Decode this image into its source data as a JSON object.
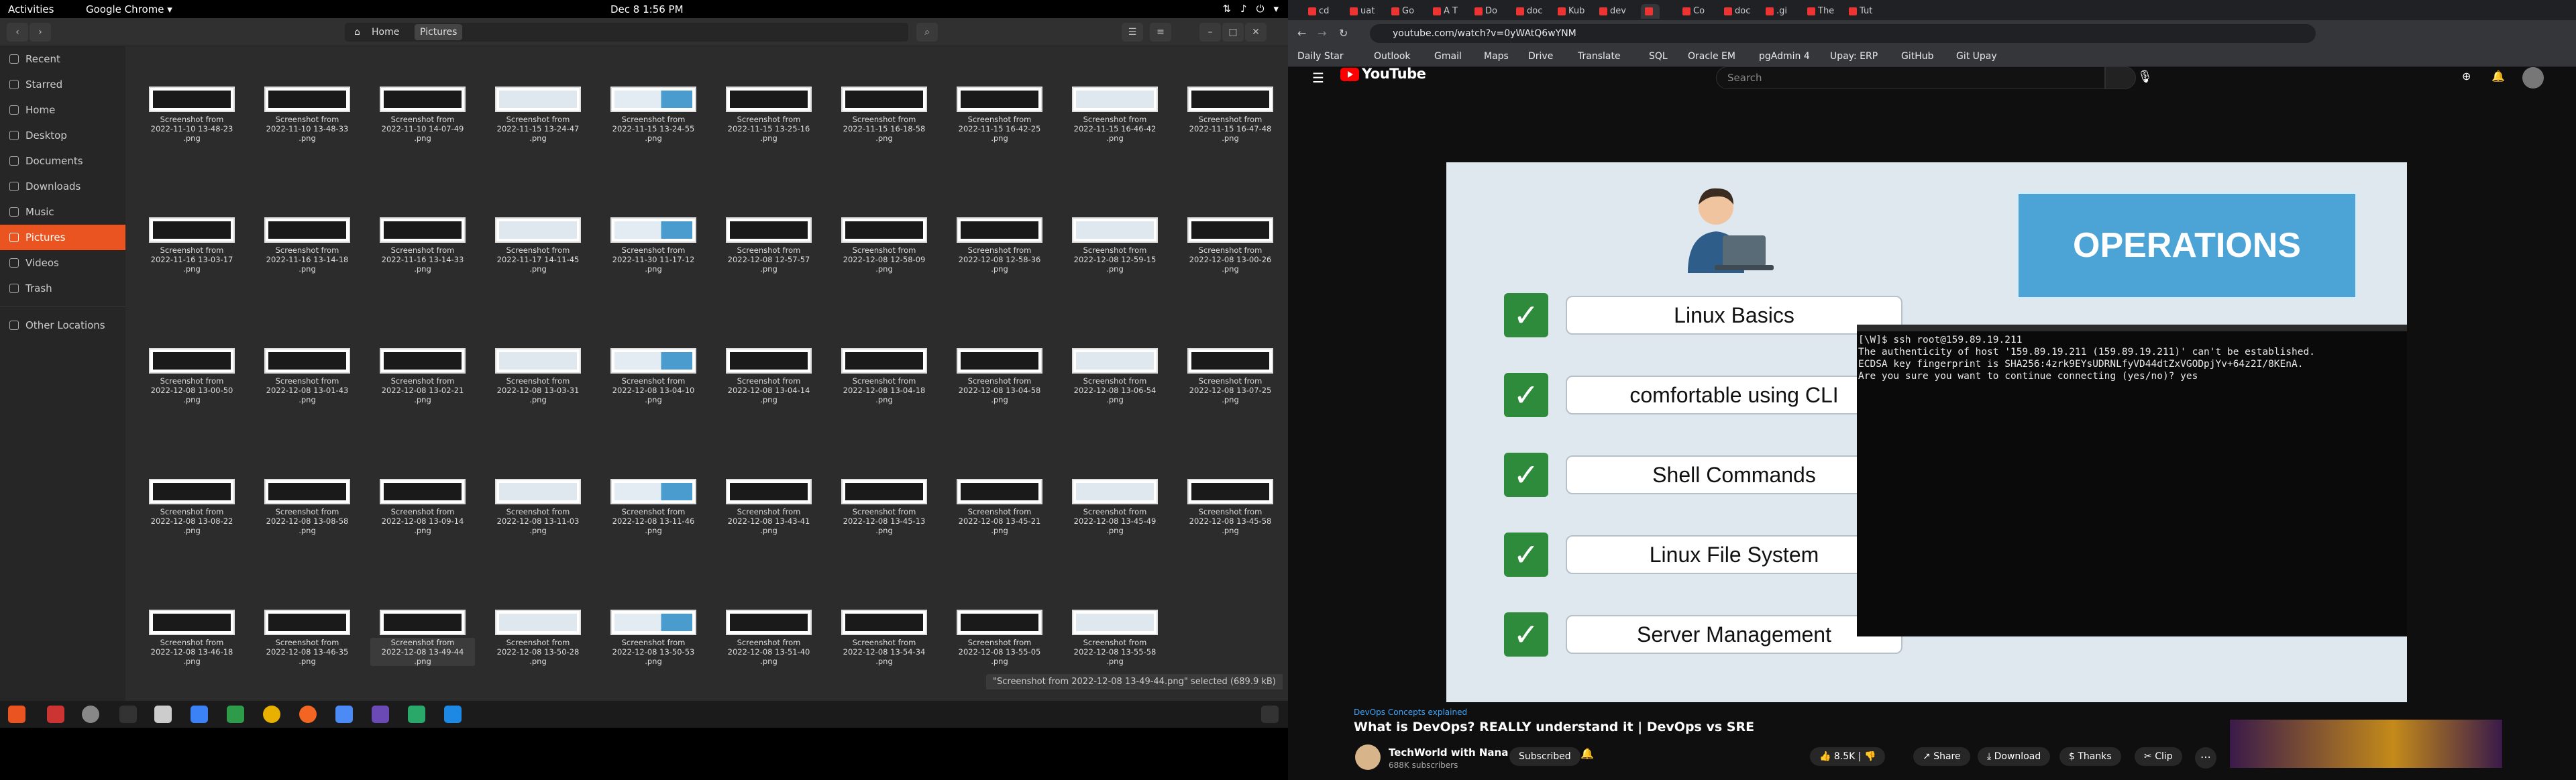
{
  "topbar": {
    "activities": "Activities",
    "app": "Google Chrome ▾",
    "clock": "Dec 8  1:56 PM"
  },
  "files": {
    "nav": {
      "home": "Home",
      "pictures": "Pictures"
    },
    "sidebar": [
      {
        "label": "Recent",
        "icon": "clock-icon"
      },
      {
        "label": "Starred",
        "icon": "star-icon"
      },
      {
        "label": "Home",
        "icon": "home-icon"
      },
      {
        "label": "Desktop",
        "icon": "desktop-icon"
      },
      {
        "label": "Documents",
        "icon": "document-icon"
      },
      {
        "label": "Downloads",
        "icon": "download-icon"
      },
      {
        "label": "Music",
        "icon": "music-icon"
      },
      {
        "label": "Pictures",
        "icon": "image-icon",
        "selected": true
      },
      {
        "label": "Videos",
        "icon": "video-icon"
      },
      {
        "label": "Trash",
        "icon": "trash-icon"
      },
      {
        "label": "Other Locations",
        "icon": "plus-icon"
      }
    ],
    "files": [
      "2022-11-10 13-48-23",
      "2022-11-10 13-48-33",
      "2022-11-10 14-07-49",
      "2022-11-15 13-24-47",
      "2022-11-15 13-24-55",
      "2022-11-15 13-25-16",
      "2022-11-15 16-18-58",
      "2022-11-15 16-42-25",
      "2022-11-15 16-46-42",
      "2022-11-15 16-47-48",
      "2022-11-16 13-03-17",
      "2022-11-16 13-14-18",
      "2022-11-16 13-14-33",
      "2022-11-17 14-11-45",
      "2022-11-30 11-17-12",
      "2022-12-08 12-57-57",
      "2022-12-08 12-58-09",
      "2022-12-08 12-58-36",
      "2022-12-08 12-59-15",
      "2022-12-08 13-00-26",
      "2022-12-08 13-00-50",
      "2022-12-08 13-01-43",
      "2022-12-08 13-02-21",
      "2022-12-08 13-03-31",
      "2022-12-08 13-04-10",
      "2022-12-08 13-04-14",
      "2022-12-08 13-04-18",
      "2022-12-08 13-04-58",
      "2022-12-08 13-06-54",
      "2022-12-08 13-07-25",
      "2022-12-08 13-08-22",
      "2022-12-08 13-08-58",
      "2022-12-08 13-09-14",
      "2022-12-08 13-11-03",
      "2022-12-08 13-11-46",
      "2022-12-08 13-43-41",
      "2022-12-08 13-45-13",
      "2022-12-08 13-45-21",
      "2022-12-08 13-45-49",
      "2022-12-08 13-45-58",
      "2022-12-08 13-46-18",
      "2022-12-08 13-46-35",
      "2022-12-08 13-49-44",
      "2022-12-08 13-50-28",
      "2022-12-08 13-50-53",
      "2022-12-08 13-51-40",
      "2022-12-08 13-54-34",
      "2022-12-08 13-55-05",
      "2022-12-08 13-55-58"
    ],
    "file_prefix": "Screenshot from",
    "file_suffix": ".png",
    "selected_index": 42,
    "status": "\"Screenshot from 2022-12-08 13-49-44.png\" selected (689.9 kB)"
  },
  "chrome": {
    "tabs": [
      "cd",
      "uat",
      "Go",
      "A T",
      "Do",
      "doc",
      "Kub",
      "dev",
      "",
      "Co",
      "doc",
      ".gi",
      "The",
      "Tut"
    ],
    "url": "youtube.com/watch?v=0yWAtQ6wYNM",
    "bookmarks": [
      "Daily Star",
      "Outlook",
      "Gmail",
      "Maps",
      "Drive",
      "Translate",
      "SQL",
      "Oracle EM",
      "pgAdmin 4",
      "Upay: ERP",
      "GitHub",
      "Git Upay"
    ]
  },
  "youtube": {
    "logo": "YouTube",
    "search_placeholder": "Search",
    "video": {
      "banner": "OPERATIONS",
      "skills": [
        "Linux Basics",
        "comfortable using CLI",
        "Shell Commands",
        "Linux File System",
        "Server Management"
      ],
      "terminal": [
        "[\\W]$ ssh root@159.89.19.211",
        "The authenticity of host '159.89.19.211 (159.89.19.211)' can't be established.",
        "ECDSA key fingerprint is SHA256:4zrk9EYsUDRNLfyVD44dtZxVGODpjYv+64z2I/8KEnA.",
        "Are you sure you want to continue connecting (yes/no)? yes"
      ]
    },
    "hashtag": "DevOps Concepts explained",
    "title": "What is DevOps? REALLY understand it | DevOps vs SRE",
    "channel": "TechWorld with Nana",
    "subscribers": "688K subscribers",
    "subscribed": "Subscribed",
    "likes": "8.5K",
    "share": "Share",
    "download": "Download",
    "thanks": "Thanks",
    "clip": "Clip"
  }
}
